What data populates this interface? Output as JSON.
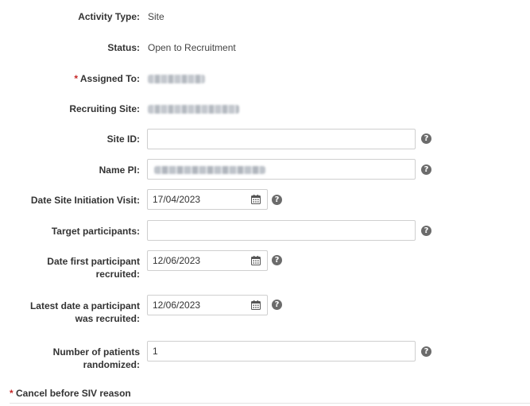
{
  "fields": {
    "activity_type": {
      "label": "Activity Type:",
      "value": "Site"
    },
    "status": {
      "label": "Status:",
      "value": "Open to Recruitment"
    },
    "assigned_to": {
      "label": "Assigned To:",
      "required_marker": "*"
    },
    "recruiting_site": {
      "label": "Recruiting Site:"
    },
    "site_id": {
      "label": "Site ID:",
      "value": ""
    },
    "name_pi": {
      "label": "Name PI:"
    },
    "date_siv": {
      "label": "Date Site Initiation Visit:",
      "value": "17/04/2023"
    },
    "target_participants": {
      "label": "Target participants:",
      "value": ""
    },
    "date_first_participant": {
      "label_line1": "Date first participant",
      "label_line2": "recruited:",
      "value": "12/06/2023"
    },
    "latest_date_participant": {
      "label_line1": "Latest date a participant",
      "label_line2": "was recruited:",
      "value": "12/06/2023"
    },
    "patients_randomized": {
      "label_line1": "Number of patients",
      "label_line2": "randomized:",
      "value": "1"
    },
    "cancel_before_siv": {
      "label": "Cancel before SIV reason",
      "required_marker": "*"
    }
  },
  "icons": {
    "help": "question-circle-icon",
    "help_glyph": "?",
    "calendar": "calendar-icon"
  },
  "colors": {
    "required": "#c62828",
    "help_icon": "#6b6b6b",
    "input_border": "#cfcfcf"
  }
}
